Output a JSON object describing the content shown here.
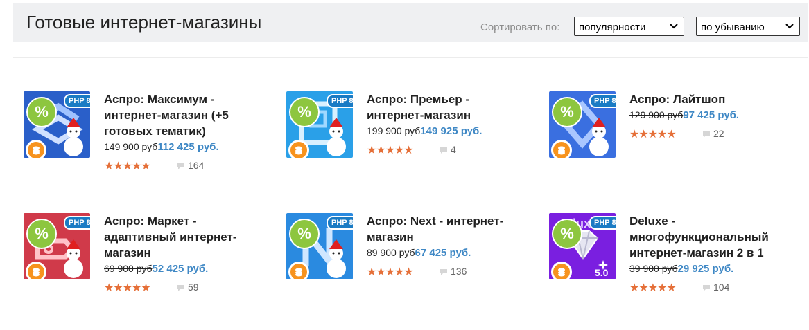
{
  "header": {
    "title": "Готовые интернет-магазины",
    "sort_label": "Сортировать по:",
    "sort_by": "популярности",
    "sort_order": "по убыванию"
  },
  "badges": {
    "discount": "%",
    "php": "PHP 8"
  },
  "products": [
    {
      "title": "Аспро: Максимум - интернет-магазин (+5 готовых тематик)",
      "old_price": "149 900 руб",
      "new_price": "112 425 руб.",
      "stars": "★★★★★",
      "rating": 5,
      "reviews": "164",
      "color": "#2a5fc9"
    },
    {
      "title": "Аспро: Премьер - интернет-магазин",
      "old_price": "199 900 руб",
      "new_price": "149 925 руб.",
      "stars": "★★★★★",
      "rating": 5,
      "reviews": "4",
      "color": "#2aa0e8"
    },
    {
      "title": "Аспро: Лайтшоп",
      "old_price": "129 900 руб",
      "new_price": "97 425 руб.",
      "stars": "★★★★★",
      "rating": 5,
      "reviews": "22",
      "color": "#3a6fe0"
    },
    {
      "title": "Аспро: Маркет - адаптивный интернет-магазин",
      "old_price": "69 900 руб",
      "new_price": "52 425 руб.",
      "stars": "★★★★★",
      "rating": 5,
      "reviews": "59",
      "color": "#d03a4a"
    },
    {
      "title": "Аспро: Next - интернет-магазин",
      "old_price": "89 900 руб",
      "new_price": "67 425 руб.",
      "stars": "★★★★★",
      "rating": 5,
      "reviews": "136",
      "color": "#2a8ae0"
    },
    {
      "title": "Deluxe - многофункциональный интернет-магазин 2 в 1",
      "old_price": "39 900 руб",
      "new_price": "29 925 руб.",
      "stars": "★★★★★",
      "rating": 5,
      "reviews": "104",
      "color": "#7a1fe0",
      "thumb_label": "5.0",
      "thumb_text": "luxe"
    }
  ],
  "icons": {
    "select_arrow": "chevron-down-icon",
    "reviews": "comment-icon",
    "coin": "coins-icon",
    "snowman": "snowman-icon",
    "diamond": "diamond-icon"
  }
}
